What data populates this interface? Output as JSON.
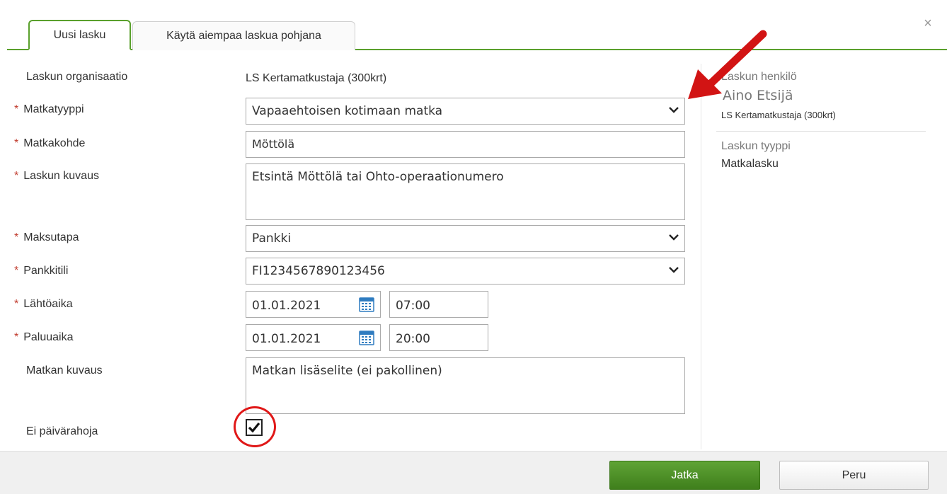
{
  "tabs": [
    {
      "label": "Uusi lasku",
      "active": true
    },
    {
      "label": "Käytä aiempaa laskua pohjana",
      "active": false
    }
  ],
  "close_icon": "close-icon",
  "form": {
    "required_marker": "*",
    "organization": {
      "label": "Laskun organisaatio",
      "value": "LS Kertamatkustaja (300krt)"
    },
    "travel_type": {
      "label": "Matkatyyppi",
      "value": "Vapaaehtoisen kotimaan matka"
    },
    "destination": {
      "label": "Matkakohde",
      "value": "Möttölä"
    },
    "invoice_description": {
      "label": "Laskun kuvaus",
      "value": "Etsintä Möttölä tai Ohto-operaationumero"
    },
    "payment_method": {
      "label": "Maksutapa",
      "value": "Pankki"
    },
    "bank_account": {
      "label": "Pankkitili",
      "value": "FI1234567890123456"
    },
    "departure": {
      "label": "Lähtöaika",
      "date": "01.01.2021",
      "time": "07:00"
    },
    "return": {
      "label": "Paluuaika",
      "date": "01.01.2021",
      "time": "20:00"
    },
    "trip_description": {
      "label": "Matkan kuvaus",
      "value": "Matkan lisäselite (ei pakollinen)"
    },
    "no_per_diem": {
      "label": "Ei päivärahoja",
      "checked": true
    }
  },
  "side_panel": {
    "person_label": "Laskun henkilö",
    "person_name": "Aino Etsijä",
    "person_org": "LS Kertamatkustaja (300krt)",
    "type_label": "Laskun tyyppi",
    "type_value": "Matkalasku"
  },
  "footer": {
    "continue_label": "Jatka",
    "cancel_label": "Peru"
  },
  "colors": {
    "accent_green": "#5aa02c",
    "required_red": "#c0392b",
    "annotation_red": "#e01818"
  }
}
